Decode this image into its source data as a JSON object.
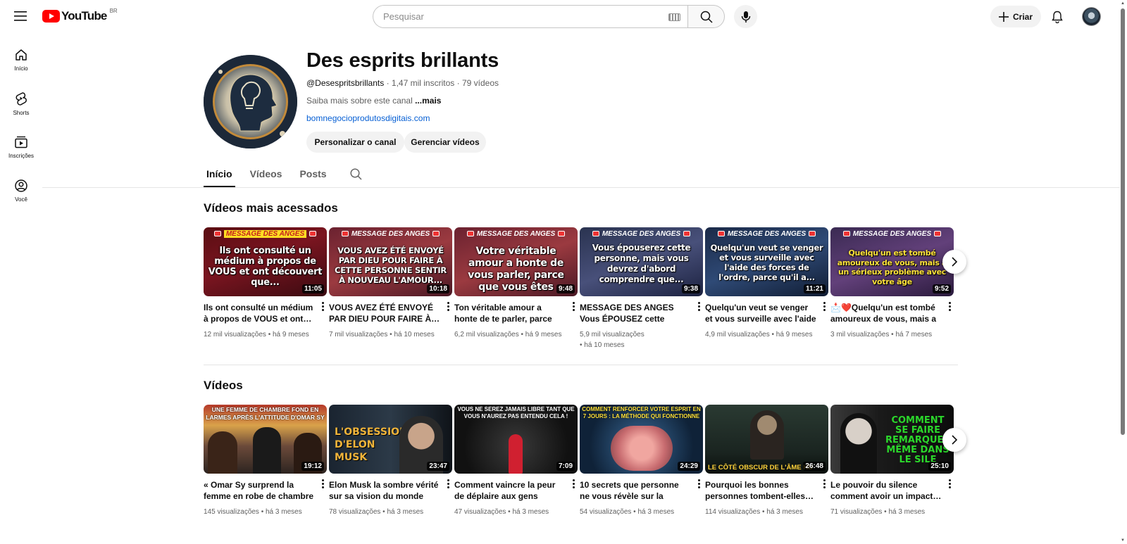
{
  "masthead": {
    "logo_text": "YouTube",
    "logo_region": "BR",
    "search_placeholder": "Pesquisar",
    "create_label": "Criar"
  },
  "guide": {
    "items": [
      {
        "label": "Início",
        "icon": "home-icon"
      },
      {
        "label": "Shorts",
        "icon": "shorts-icon"
      },
      {
        "label": "Inscrições",
        "icon": "subscriptions-icon"
      },
      {
        "label": "Você",
        "icon": "you-icon"
      }
    ]
  },
  "channel": {
    "title": "Des esprits brillants",
    "handle": "@Desespritsbrillants",
    "subscribers": "1,47 mil inscritos",
    "videos_count": "79 vídeos",
    "description": "Saiba mais sobre este canal ",
    "more": "...mais",
    "link": "bomnegocioprodutosdigitais.com",
    "customize_label": "Personalizar o canal",
    "manage_label": "Gerenciar vídeos"
  },
  "tabs": [
    {
      "label": "Início",
      "active": true
    },
    {
      "label": "Vídeos",
      "active": false
    },
    {
      "label": "Posts",
      "active": false
    }
  ],
  "popular": {
    "title": "Vídeos mais acessados",
    "banner": "MESSAGE DES ANGES",
    "videos": [
      {
        "thumb_text": "Ils ont consulté un médium à propos de VOUS et ont découvert que...",
        "duration": "11:05",
        "title": "Ils ont consulté un médium à propos de VOUS et ont…",
        "views": "12 mil visualizações",
        "age": "há 9 meses"
      },
      {
        "thumb_text": "VOUS AVEZ ÉTÉ ENVOYÉ PAR DIEU POUR FAIRE À CETTE PERSONNE SENTIR À NOUVEAU L'AMOUR...",
        "duration": "10:18",
        "title": "VOUS AVEZ ÉTÉ ENVOYÉ PAR DIEU POUR FAIRE À…",
        "views": "7 mil visualizações",
        "age": "há 10 meses"
      },
      {
        "thumb_text": "Votre véritable amour a honte de vous parler, parce que vous êtes",
        "duration": "9:48",
        "title": "Ton véritable amour a honte de te parler, parce que tu…",
        "views": "6,2 mil visualizações",
        "age": "há 9 meses"
      },
      {
        "thumb_text": "Vous épouserez cette personne, mais vous devrez d'abord comprendre que...",
        "duration": "9:38",
        "title": "MESSAGE DES ANGES Vous ÉPOUSEZ cette personne,…",
        "views": "5,9 mil visualizações",
        "age": "há 10 meses"
      },
      {
        "thumb_text": "Quelqu'un veut se venger et vous surveille avec l'aide des forces de l'ordre, parce qu'il a...",
        "duration": "11:21",
        "title": "Quelqu'un veut se venger et vous surveille avec l'aide de…",
        "views": "4,9 mil visualizações",
        "age": "há 9 meses"
      },
      {
        "thumb_text": "Quelqu'un est tombé amoureux de vous, mais a un sérieux problème avec votre âge",
        "duration": "9:52",
        "title": "📩❤️Quelqu'un est tombé amoureux de vous, mais a u…",
        "views": "3 mil visualizações",
        "age": "há 7 meses"
      }
    ]
  },
  "videos": {
    "title": "Vídeos",
    "items": [
      {
        "thumb_text": "UNE FEMME DE CHAMBRE FOND EN LARMES APRÈS L'ATTITUDE D'OMAR SY",
        "duration": "19:12",
        "title": "« Omar Sy surprend la femme en robe de chambre par un…",
        "views": "145 visualizações",
        "age": "há 3 meses"
      },
      {
        "thumb_text": "L'OBSESSION D'ELON MUSK",
        "duration": "23:47",
        "title": "Elon Musk la sombre vérité sur sa vision du monde",
        "views": "78 visualizações",
        "age": "há 3 meses"
      },
      {
        "thumb_text": "VOUS NE SEREZ JAMAIS LIBRE TANT QUE VOUS N'AUREZ PAS ENTENDU CELA !",
        "duration": "7:09",
        "title": "Comment vaincre la peur de déplaire aux gens",
        "views": "47 visualizações",
        "age": "há 3 meses"
      },
      {
        "thumb_text": "COMMENT RENFORCER VOTRE ESPRIT EN 7 JOURS : LA MÉTHODE QUI FONCTIONNE",
        "duration": "24:29",
        "title": "10 secrets que personne ne vous révèle sur la capacité …",
        "views": "54 visualizações",
        "age": "há 3 meses"
      },
      {
        "thumb_text": "LE CÔTÉ OBSCUR DE L'ÂME HU",
        "duration": "26:48",
        "title": "Pourquoi les bonnes personnes tombent-elles…",
        "views": "114 visualizações",
        "age": "há 3 meses"
      },
      {
        "thumb_text": "COMMENT SE FAIRE REMARQUER MÊME DANS LE SILE",
        "duration": "25:10",
        "title": "Le pouvoir du silence comment avoir un impact…",
        "views": "71 visualizações",
        "age": "há 3 meses"
      }
    ]
  }
}
